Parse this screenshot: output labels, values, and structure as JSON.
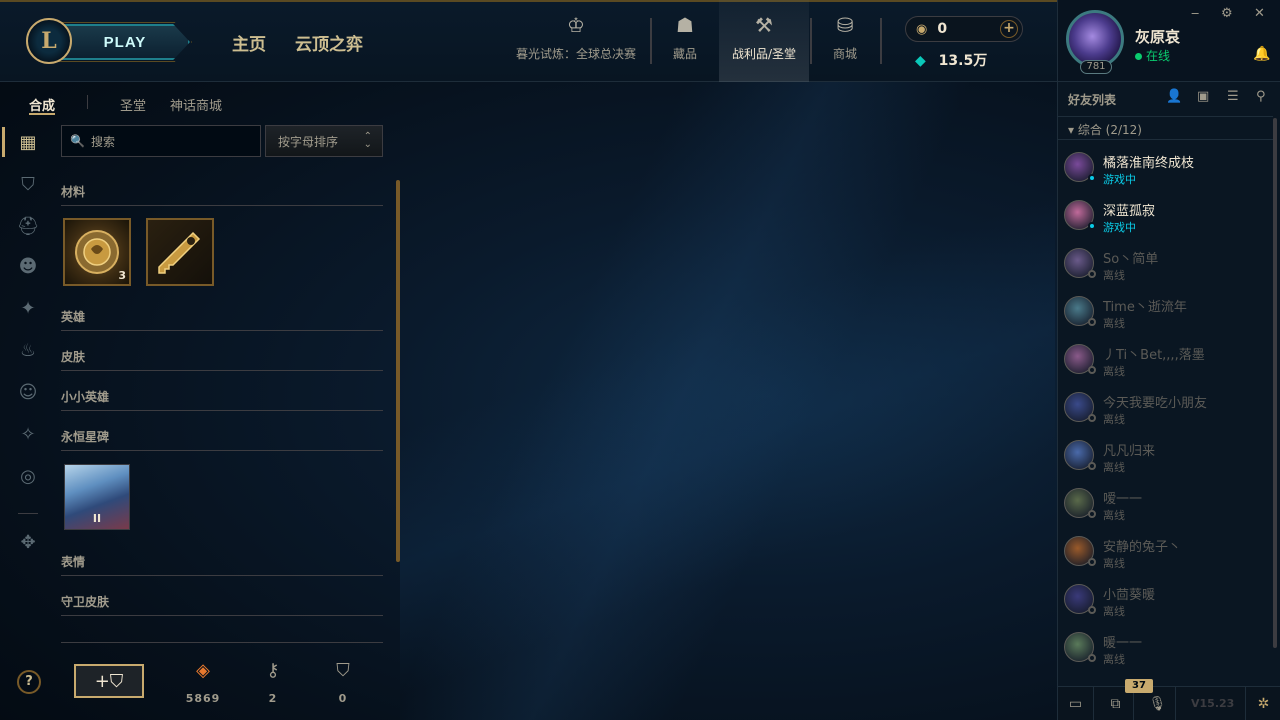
{
  "header": {
    "logo_glyph": "L",
    "play_label": "PLAY",
    "nav_main": [
      "主页",
      "云顶之弈"
    ],
    "nav_icons": [
      {
        "label": "暮光试炼：全球总决赛",
        "icon": "worlds-trophy-icon",
        "glyph": "♔"
      },
      {
        "label": "藏品",
        "icon": "collection-bag-icon",
        "glyph": "☗"
      },
      {
        "label": "战利品/圣堂",
        "icon": "loot-hammer-icon",
        "glyph": "⚒"
      },
      {
        "label": "商城",
        "icon": "store-coins-icon",
        "glyph": "⛁"
      }
    ],
    "rp": "0",
    "rp_glyph": "◉",
    "plus_glyph": "+",
    "be": "13.5万",
    "be_glyph": "◆"
  },
  "profile": {
    "name": "灰原哀",
    "status": "在线",
    "level": "781",
    "window": {
      "minimize": "‒",
      "settings": "⚙",
      "close": "✕"
    },
    "bell": "🔔"
  },
  "subtabs": [
    "合成",
    "圣堂",
    "神话商城"
  ],
  "sidenav": [
    {
      "icon": "grid-icon",
      "glyph": "▦"
    },
    {
      "icon": "chest-icon",
      "glyph": "⛉"
    },
    {
      "icon": "champion-helmet-icon",
      "glyph": "⛑"
    },
    {
      "icon": "skin-mask-icon",
      "glyph": "☻"
    },
    {
      "icon": "ward-icon",
      "glyph": "✦"
    },
    {
      "icon": "little-legend-icon",
      "glyph": "♨"
    },
    {
      "icon": "emote-icon",
      "glyph": "☺"
    },
    {
      "icon": "eternals-icon",
      "glyph": "✧"
    },
    {
      "icon": "icon-portrait-icon",
      "glyph": "◎"
    },
    {
      "icon": "tft-icon",
      "glyph": "✥"
    }
  ],
  "search": {
    "placeholder": "搜索",
    "icon_glyph": "🔍"
  },
  "sort": {
    "selected": "按字母排序",
    "chevron": "⌃⌄"
  },
  "categories": {
    "materials": "材料",
    "champions": "英雄",
    "skins": "皮肤",
    "little_legends": "小小英雄",
    "eternals": "永恒星碑",
    "emotes": "表情",
    "ward_skins": "守卫皮肤"
  },
  "materials": [
    {
      "name": "hextech-chest",
      "count": "3",
      "glyph": "⚙"
    },
    {
      "name": "hextech-key",
      "count": "",
      "glyph": "⚷"
    }
  ],
  "eternals_item": {
    "tier": "II"
  },
  "bottom": {
    "help": "?",
    "craft_label": "+⛉",
    "resources": [
      {
        "name": "orange-essence",
        "glyph": "◈",
        "value": "5869",
        "color": "#e8792e"
      },
      {
        "name": "key-fragment",
        "glyph": "⚷",
        "value": "2",
        "color": "#a09b8c"
      },
      {
        "name": "chest",
        "glyph": "⛉",
        "value": "0",
        "color": "#a09b8c"
      }
    ]
  },
  "friends": {
    "title": "好友列表",
    "icons": [
      {
        "name": "add-friend-icon",
        "glyph": "👤"
      },
      {
        "name": "add-folder-icon",
        "glyph": "▣"
      },
      {
        "name": "list-view-icon",
        "glyph": "☰"
      },
      {
        "name": "search-icon",
        "glyph": "⚲"
      }
    ],
    "group_label": "综合 (2/12)",
    "group_chevron": "▾",
    "list": [
      {
        "name": "橘落淮南终成枝",
        "status": "游戏中",
        "online": true,
        "avatar": "#7a4a9a"
      },
      {
        "name": "深蓝孤寂",
        "status": "游戏中",
        "online": true,
        "avatar": "#c06a9a"
      },
      {
        "name": "So丶简单",
        "status": "离线",
        "online": false,
        "avatar": "#6a5a8a"
      },
      {
        "name": "Time丶逝流年",
        "status": "离线",
        "online": false,
        "avatar": "#4a7a8a"
      },
      {
        "name": "丿Ti丶Bet,,,,落墨",
        "status": "离线",
        "online": false,
        "avatar": "#8a5a8a"
      },
      {
        "name": "今天我要吃小朋友",
        "status": "离线",
        "online": false,
        "avatar": "#3a4a8a"
      },
      {
        "name": "凡凡归来",
        "status": "离线",
        "online": false,
        "avatar": "#4a6aaa"
      },
      {
        "name": "嗳一一",
        "status": "离线",
        "online": false,
        "avatar": "#5a6a4a"
      },
      {
        "name": "安静的兔子丶",
        "status": "离线",
        "online": false,
        "avatar": "#9a5a2a"
      },
      {
        "name": "小茴葵暖",
        "status": "离线",
        "online": false,
        "avatar": "#3a3a7a"
      },
      {
        "name": "暖一一",
        "status": "离线",
        "online": false,
        "avatar": "#5a7a5a"
      }
    ],
    "bottom_buttons": [
      {
        "name": "chat-icon",
        "glyph": "▭"
      },
      {
        "name": "inbox-icon",
        "glyph": "⧉"
      },
      {
        "name": "mic-icon",
        "glyph": "🎙"
      }
    ],
    "badge": "37",
    "version": "V15.23",
    "bug_glyph": "✲"
  }
}
